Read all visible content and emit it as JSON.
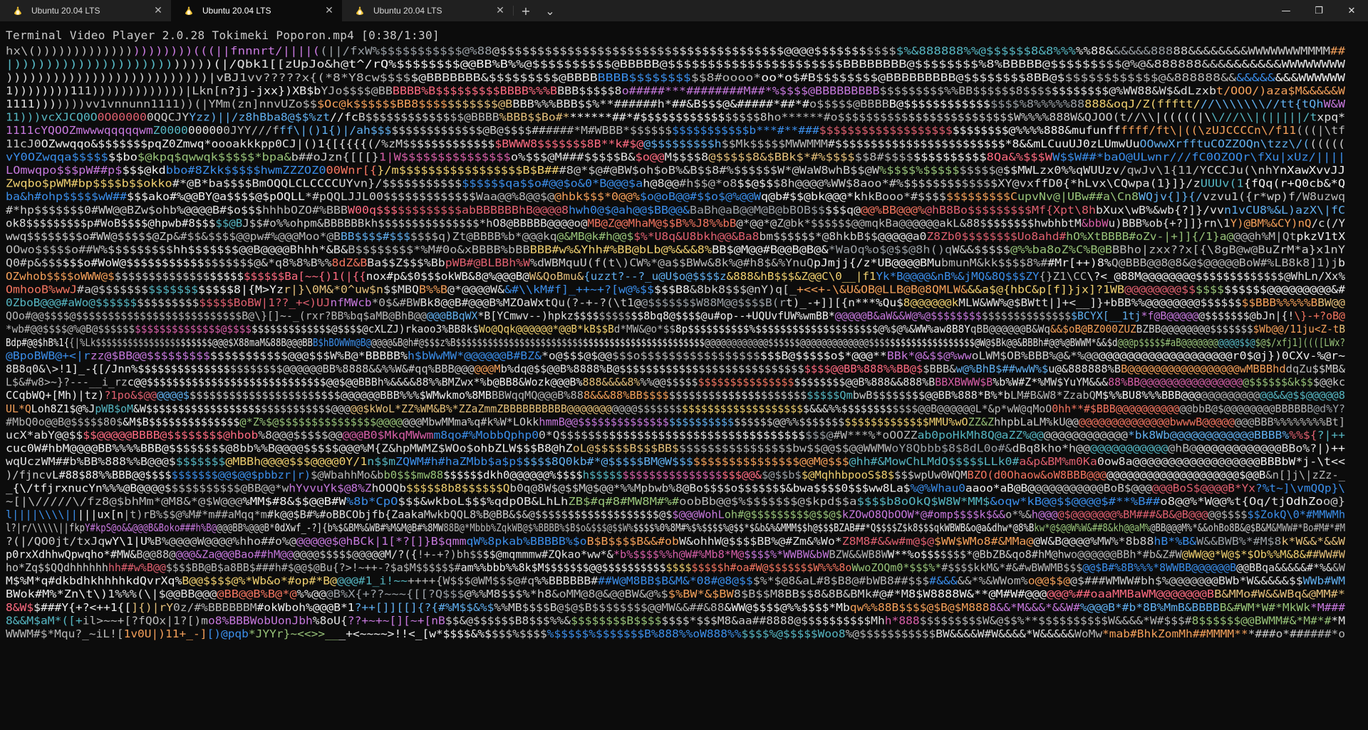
{
  "window": {
    "tabs": [
      {
        "label": "Ubuntu 20.04 LTS",
        "active": false
      },
      {
        "label": "Ubuntu 20.04 LTS",
        "active": true
      },
      {
        "label": "Ubuntu 20.04 LTS",
        "active": false
      }
    ],
    "new_tab_glyph": "+",
    "dropdown_glyph": "⌄",
    "minimize_glyph": "—",
    "maximize_glyph": "❐",
    "close_glyph": "✕",
    "tab_close_glyph": "✕"
  },
  "terminal": {
    "status": "Terminal Video Player 2.0.28 Tokimeki Poporon.mp4 [0:38/1:30]",
    "ascii_rows": [
      "hx\\()))))))))))))))))))))(((||fnnnrt/||||((||/fxW%$$$$$$$$$$$@%88@$$$$$$$$$$$$$$$$$$$$$$$$$$$$$$$$$$$$$$@@@@$$$$$$$$$$$$%&888888%%@$$$$$$8&8%%%%%88&&&&&&88888&&&&&&&&WWWWWWWMMMM##",
      "|)))))))))))))))))))))))))(|/Qbk1[[zUpJo&h@t^/rQ%$$$$$$$$@@BB%B%%@$$$$$$$$$$@BBBBB@$$$$$$$$$$$$$$$$$$$$$$BBBBBBBB@$$$$$$$$%8%BBBBB@$$$$$$$$$@%@&888888&&&&&&&&&&WWWWWWWW",
      "))))))))))))))))))))))))))|vBJ1vv?????x{(*8*Y8cw$$$$$@BBBBBBB&$$$$$$$$$@BBBBBBBB$$$$$$$$$$8#oooo*oo*o$#B$$$$$$$$@BBBBBBBBB@$$$$$$$$8BB@$$$$$$$$$$$$$@&888888&&&&&&&&&&WWWWWW",
      "1))))))))111)))))))))))))|Lkn[n?jj-jxx})XB$bYJo$$$$@BBBBBB%B$$$$$$$$$BBBB%%%BBBB$$$$$8o#####***########M##*%$$$$@BBBBBBBBB$$$$$$$$$%%BB$$$$$$8$$$$$$$$$$$$@%WW88&W$&dLzxbt/OOO/)aza$M&&&&&W",
      "1111)))))))vv1vnnunn1111))(|YMm(zn]nnvUZo$$$Oc@k$$$$$$BB8$$$$$$$$$$$@BBBB%%%BBB$$%**######h*##&B$$$@&#####*##*#o$$$$$@BBBBB@$$$$$$$$$$$$$$$$%8%%%%%88888&oqJ/Z(ffftt///\\\\\\\\\\\\\\//tt{tQhW&W",
      "11)))vcXJCQ0O0O000000QQCJYYzz)||/z8hBba8@$$%zt//fcB$$$$$$$$$$$$$$@BBBB%BBB$$Bo#*******##*#$$$$$$$$$$$$$$$$$8ho******#o$$$$$$$$$$$$$$$$$$$$$$$$$W%%%%888W&QJOO(t//\\\\|(((((|\\\\///\\\\|(|||||/txpq*",
      "1111cYQOOZmwwwqqqqqwmZ0000000000JYY///fff\\|()1{)|/ah$$$$$$$$$$$$$$$$@B@$$$$######*M#WBBB*$$$$$$$$$$$$$$$$$b***#**###$$$$$$$$$$$$$$$$$$$$$$$$$$$@%%%%888&mufunffffff/ft\\|((\\zUJCCCCn\\/f11(((|\\tf",
      "11cJ0OZwwqqo&$$$$$$$pqZ0Zmwq*oooakkkpp0CJ|()1{[{{{{(/%zM$$$$$$$$$$$$$$BWWW8$$$$$$$8B**k#$@@$$$$$$$$$h$$Mk$$$$$MWWMMM#$$$$$$$$$$$$$$$$$$$$$$$$*8&&mLCuuUJ0zLUmwUuOOwwXrfftuCOZZOQn\\tzz\\/((((((",
      "vY0OZwqqa$$$$$$$bo$@kpq$qwwqk$$$$$*bpa&b##oJzn{[[[}1|W$$$$$$$$$$$$$$$o%$$$@M###$$$$$B&$o@@M$$$$8@$$$$$8&$BBk$*#%$$$$$$8#$$$$$$$$$$$$$$8Qa&%$$$WW$$W##*baO@ULwnr///fC0OZOQr\\fXu|xUz/||||",
      "LOmwqpo$$$pW##p$$$$@kdbbo#8Zkk$$$$$hwmZZZOZ000Wnr[{}/m$$$$$$$$$$$$$$$$$B$B###8@*$@#@BW$oh$oB%&B$$8#%$$$$$$W*@WaW8whB$$@W%$$$$%$$$$$$$$$$@$$MWLzx0%%qWUUzv/qwJv\\1{11/YCCCJu(\\nhYnXawXvvJJ",
      "Zwqbo$pWM#bp$$$$b$$okko#*@B*ba$$$$BmOQQLCLCCCCUYvn}/$$$$$$$$$$$$$$$$$qa$$o#@@$o&0*B@@@$ah@8@@#h$$@*o8$$@$$$8h@@@@%WW$8aoo*#%$$$$$$$$$$$$$XY@vxffD0{*hLvx\\CQwpa(1}]}/zUUUv(1{fQq(r+Q0cb&*Q",
      "ba&h#ohp$$$$$wW##$$$ako#%@@BY@a$$$$@$pOQLL*#pQQLJJL00$$$$$$$$$$$$$Waa@@%8@@$@@hbk$$$*0@@%$o@oB@@#$$o$@%@@Wq@b#$$@bk@@@*khkBooo*#$$$$$$$$$$$$$CupvNv@|UBw##a\\Cn8WQjv{]}{/vzvu1({r*wp)f/W8uzwq",
      "#*hp$$$$$$$0#WW@@BZw$ohb%@@@@B#$o$$$hhhbOZO#%BBBW00q$$$$$$$$$$$$abBBBBBBhB@@@@8hwh0@$@ah@@$BB@@&BaBh@aB@@M@B@bBOB$$$$$q@@@%BB@@@%@hB8Bo$$$$$$$$$Mf{Xpt\\8hbXux\\wB%&wb{?]}/vvn1vCU8%&L)azX\\|fC",
      "ok8$$$$$$$$$p#WoB$$$$@hpwb#8$$$$$@BJ$$#o%%ohpm&BBBBBBkh$$$$$$$$$$$$$$$*hO8@BBBBB@@@@o@MB@Z@@MhaM@$$B%%J8%%bB@*@@*@Z@bk*$$$$$$@@mqkBa@@@@@@akL&88$$$$$$$$hwbhbtM&bbWu)BBB%ob{+?]]}rn\\1Y)@BM%&CY)nQ/c(/Y",
      "wwq$$$$$$$$o#WW@$$$$$@Zp&#$$&$$$$@@pw#%@@@Moo*@BBB$$$$#$$$$$$$q)Zt@BBBB%b*@@@kq@&MB@k#h@@$$%*U8q&U8bkh@@&Ba8bm$$$$$$*@8hkbB$$@@@@@a0Z8Zb0$$$$$$$$Uo8ahd#hO%XtBBBB#oZv-|+]]{/1}a@@@@h%M|QtpkzV1tX",
      "OOwo$$$$$o##W%$$$$$$$$$hh$$$$$$$@@B@@@@Bhhh*&B&B$$$$$$$$*%M#0o&xBBBB%bBBBBB#w%&Yhh#%BB@bLb@%&&&8%BB$@M@@#B@@B@B@&*WaOq%o$@$$@8h()qW&&$$$$$@%%ba8oZ%C%B@BBBho|zxx??x[{\\8gB@w@BuZrM*a}x1nY",
      "Q0#p&$$$$$$o#WoW@$$$$$$$$$$$$$$$$$$@&*q8%8%B%%8dZ&BBa$$Z$$$%BbpWB#@BLBBh%W%dWBMquU(f(t\\)CW%*@a$$BWw&8k%@#h8$&%YnuQpJmjj{/z*UB@@@@BMubmunM&kk$$$$8%##Mr[++)8%Q@BBB@@8@8&@$@@@@@BoW#%LB8k8]1)jb",
      "OZwhob$$$$oWWW@$$$$$$$$$$$$$$$$$$$$$$$$$$Ba[~~{)1(|{{nox#p&$0$$$okWB&8@%@@@B@W&QoBmu&{uzzt?--?_u@U$o@$$$$z&888&hB$$$&Z@@C\\0__|f1Yk*B@@@@&nB%&jMQ&8Q$$$ZY{}Z1\\CC\\?<_@88M@@@@@@@@$$$$$$$$$$$$$@WhLn/Xx%",
      "OmhooB%wwJ#a@$$$$$$$$$$$$$$$$$$$8|{M>Yzr|}\\0M&*0^uw$n$$MBQB%%B@*@@@@W&&#\\\\kM#f]_++~+?[w@%$$$$$B8&8bk8$$$@nY)q[_+<<+-\\&U&OB@LLB@B@8QMLW&&&a$@{hbC&p[f]}jx]?1WB@@@@@@@@$$$$$$$$$$$$@@@@@@@@@&#",
      "0ZboB@@@#aWo@$$$$$$$$$$$$$$$$$$$$BoBW|1??_+<)UJnfMWcb*0$&#BWBk8@@B#@@@B%MZOaWxtQu(?-+-?(\\t1@@$$$$$$$W88M@@$$$$B(rt)_-+]][{n***%Qu$8@@@@@@kMLW&WW%@$BWtt|]+<__]}+bBB%%@@@@@@@@$$$$$$$$BBB%%%%%BBW@@",
      "QOo#@@$$$$@$$$$$$$$$$$$$$$$$$$$$$$$$$B@\\}[]~-_(rxr?BB%bq$aMB@BhB@@@@@BBqWX*B[YCmwv--)hpkz$$$$$$$$$$$8bq8@$$$$@u#op--+UQUvfUW%wmBB*@@@@@B&aW&&W@%@$$$$$$$$$$$$$$$$$$$$$$$BCYX[__1tj*f@B@@@@@@$$$$$$$@bJn|{!\\}-+?oB@",
      "*wb#@@$$$$@%@B@$$$$$$$$$$$$$$$$$$$$@$$$$$$$$$$$$$$$$$@$$$$@cXLZJ)rkaoo3%BB8k$Wo@Qqk@@@@@@*@@B*kB$$Bd*MW&@o*$$8p$$$$$$$$$$%$$$$$$$$$$$$$$$$$$$$@%$@%&WW%aw8B8YqBB@@@@@@B&Wq&&$oB@BZ000ZUZBZBB@@@@@@@@$$$$$$$$Wb@@/11ju<Z-tB",
      "Bdp#@@$hB%1{{|%Lk$$$$$$$$$$$$$$$$$$$$$$@@@$X88maM&88B@@@BBB$hBOWWm@B@@@@@&B@h#@$$$z%B$$$$$$$$$$$$$$$$$$$$$$$$$$$$$$$$$$$$$$$$$$$$$$$@@@@@@@@@@@@$$$$$$@@@@@@@@@@@@@$$$$$$$$$$$$$$$$$$$$@W@$Bk@@&BBBh#@@%@BWWM*&&$d@@@p$$$$$#aB@@@@@@@@@@@$$@$@$/xfj1]((([LWx?",
      "@BpoBWB@+<|rzz@$BB@@$$$$$$$$$$$$$$$$$$$$@@@$$$W%B@*BBBBB%h$bWwMW*@@@@@@B#BZ&*o@$$$@$@@$$$o$$$$$$$$$$$$$$$$$$$$B@$$$$$o$*@@@**BBk*@&$$@%wwoLWM$OB%BBB%@&*%@@@@@@@@@@@@@@@@@@@@@r0$@j})0CXv-%@r~",
      "8B8q0&\\>!1]_-{[/Jnn%$$$$$$$$$$$$$$$$$$$$$$@@@@@@BB%8888&&%%W&#qq%BBB@@@@@@Mb%dq@$$@@B%8888%B@$$$$$$$$$$$$$$$$$$$$$$$$$$$$$$$$@@BB%888%%BB@$$BBB&w@%BhB$##wwW%$u@&888888%BB@@@@@@@@@@@@@@@@@wMBBBhddqZu$$MB&",
      "L$&#w8>~}?---__i_rzc@@$$$$$$$$$$$$$$$$$$$$$$$$$$$$@@$@@BBBh%&&&&88%%BMZwx*%b@BB8&Wozk@@@B%888&&&&8%%%@@$$$$$$$$$$$$$$$$$$$$$$$$$$$$@@B%888&&888%BBBXBWWW$B%b%W#Z*%MW$YuYM&&&88%BB@@@@@@@@@@@@@@@@@$$$$$$&k$$$@@kc",
      "CCqbWQ+[Mh)|tz)?1po&$@@@@@@$$$$$$$$$$$$$$$$$$$$$$$$@@@@@@BBB%%%$WMwkmo%8MBBBWqqMQ@@@B%888&&&88%BB$$$$$$$$$$$$$$$$$$$$$$$$$$$$$$QmbwB$$$$$$$$@@BB%888*B%*bLM#B&W8*ZzabQM$%%BU8%%%BBB@@@@@@@@@@@@@@&&@$$@@@@@8",
      "UL*QLoh8Z1$@%JpWB$oM&W$$$$$$$$$$$$$$$$$$$$$$$$$$$$$@@@@@$kWoL*ZZ%WM&B%*ZZaZmmZBBBBBBBBBB@@@@@@@@@@@$$$$$$$$$$$$$$$$$$$$$$$$$$$&&&%%$$$$$$$$$$$$@@B@@@@@@L*&p*wW@qMoO0hh**#$BBB@@@@@@@@@@@@bbB@$@@@@@@@@BBBBBB@d%Y?",
      "#MbQ0o@@B@$$$$$80$&M$B$$$$$$$$$$$$$$@*Z%$@$$$$$$$$$$$$$$$@@@@@@@MbwMMma%q#k%W*LOkkhmmB@@$$$$$$$$$$$$$$$$$$$$$$$$$$$$$$@@%%$$$$$$$$$$$$$$$$$$$$MMU%wOZZ&ZhhpbLaLM%kU@@@@@@@@@@@@@@@@bwwwB@@@@@@@@BBB%%%%%%%%Bt]",
      "ucX*abY@@$$$$@@@@@BBBB@$$$$$$$$@hbob%8@@@$$$$$@@@@@B0$MkqMWwmm8qo#%MobbQphp00*Q$$$$$$$$$$$$$$$$$$$$$$$$$$$$$$$$$$$$$$@#W***%*oOOZZab0poHkMh8Q@aZZ%@@@@@@@@@@@@@@*bk8Wb@@@@@@@@@@@@BBBB%%%${?|++",
      "cuc0W#hbM@@@@BB%%%%BBB@$$$$$$$$@8bb%%B@@@@$$$$$@@@%M{Z&hpMWMZ$WOo$ohbZLW$$$B8@hZoL@$$$$$B$$$BB$$$$$$$$$$$$$$$$$bw$$@@$$@@WWMWoY8Qbbb$8$8dL0o#&dBq8kho*h@@@@@@@@@@@@@@hB@@@@@@@@@@@@@BBo%?|)++",
      "wqUczWM##b%BB%888%%B@@@$$$$$$$$@MBBh@@@@$$$@@@@0Y/1n$$mZQWM#h#haZMbb$a$p$$$$$8Q0kb#*@$$$$$BM@W$$$$$$$$$$$$$$$$$$@@M@$$$@hh#&MowChLMdO$$$$$LLk0#a&p&BM%m0Ka0ow8a@@@@@@@@@@@@@@@@@@BBBbW*j-\\t<<",
      ")/fjncvL#88$88%%BBB@@$$$$$$$$$$$@@$@@$pbbzr|r)$@WbahhMo&bb0$$$mw88$$$$$$dkh0@@@@@@%$$$$h$$$$$$$$$$$$$$$$$$$$$$$@@&$@$$b$$@MqhhbpooS$8$$$$wpUw0WQMBZO(d0Ohaow&oW8BBB@@@@@@@@@@@@@@@@@@@@@@@$@@B&n[]j\\|zZz-_",
      "_{\\/tfjrxnucYn%%%@B@@@@$$$$$$$$$$$@BB@@*whYvvuYk$@8%ZhOOQb$$$$$8b8$$$$$$Qb0q@8W$@$$M@$@@*%%Mpbwb%8@Bo$$$$o$$$$$$$&bwa$$$$0$$$ww8La$%@%Whau0aaoo*aB@B@@@@@@@@@@@BoB$@@@@@@BoS$@@@@B*Yx?%t~]\\vmQQp}\\",
      "~[|\\/////\\/fz8@$bhMm*@M8&*@$W@@@%MM$#8&$$@@B#W%8b*CpO$$$&wkboL$$$%qdpOB&LhLhZB$#q#8#MW8M#%#oobBb@@$%$$$$$$$@$kpd$$a$$$$b8oOkQ$W8W*MM$&oqw*kB@@$$@@@@$#**%B##o8@@%*W@@%t{Oq/tjOdhZoo@}",
      "l||||\\\\\\\\|||||ux[n|t)rB%$$@%M#*m##aMqq*m#k@@$B#%#oBBCObjfb{ZaakaMwkbQQL8%B@BB&$&@$$$$$$$$$$$$$$$$$$$@$$@@@WohLoh#@$$$$$$$$$@$$@$kZOwO8QbOOW*@#omp$$$$k$&&o*%&h@@@@$@@@@@@@%BM###&B&@B@@@@@$$$$$$ZokQ\\0*#MMWMh",
      "l?|r/\\\\\\\\\\||fkpY#kpS@o&&@@@B&Boko###h%B@@@@BB%@@@B*0dXwf_-?]{b%$&BM%&WB#%M&M@B#%8MW88B@*Mbbb%ZqkWB@$%BBBB%$B$o&$$$@$$W%$$$$%0%8M#%$%$$$$%@$$*$&b&%&MMM$$h@$$$BZAB##*Q$$$$Z$k8$$$qkWBWB&o@a&dhw*@8%Bkw*@$@@W%W&##8&kh@@aM%@BB@@@M%*&&ohBo8B&@$B&M&MWW#*Bo#M#*#M",
      "?(|/QO0jt/txJqwY\\1|U%B%@@@@W@@@@%hho##o%@@@@@@$@hBCk|1[*?[]}B$qmmqW%8pkab%BBBBB%$oB$B$$$$B&&#obW&ohhW@$$$$BB%@#Zm&%Wo*Z8M8#&&w#m@$@$WW$WMo8#&MMa@@W&B@@@@%MW%*8b88hB*%B&W&&BWB%*#M$8k*W&&*&&W",
      "p0rxXdhhwQpwqho*#MW&B@@88@@@@&Za@@@Bao##hM@@@@@@$$$$$@@@@@M/?({!+-+?)bh$$$$@mqmmmw#ZQkao*ww*&*b%$$$$%%h@W#%Mb8*M@$$$$%*WWBW&bWBZW&&WB8WW**%o$$$$$$$*@BbZB&qo8#hM@hwo@@@@@@BBh*#b&Z#W@WW@@*W@$*$Ob%%M&8&##WW#W",
      "ho*Zq$$QQdhhhhhhhh##w%B@@$$$$BB@B$a8BB$###h#$@@$@Bu{?>!~++-?$a$M$$$$$$#am%%bbb%%8k$M$$$$$$$@@$$$$$$$$$$$$$$$$$$$h#oa#W@$$$$$$$W%%%8oWwoZOQm0*$$$%*#$$$$kkM&*#&#wBWWMB$$$@@$B#%8B%%%*8WWBB@@@@@@B@@BBqa&&&&&#*%&&W",
      "M$%M*q#dkbdhkhhhhkdQvrXq%B@@$$$$@%*Wb&o*#op#*B@@@@#1_i!~~++++{W$$$@WM$$$@#q%%BBBBBB###W@M8BB$B&M&*08#@8@$$$%*$@8&aL#8$B8@#bWB8##$$$#&&&&&*%&WWom%o@@$$@@$###WMWW#bh$%@@@@@@@BWb*W&&&&&$$WWb#WM",
      "BWok#M%*Zn\\t\\)1%%%(\\|$@@BB@@@@BB@@B%B@*@%%@@@B%X{+??~~~{[[?Q$$$@%%M8$$$%*h8&oMM@8@&@@BW&@%$$%BW*&$BW8$B$$M8BB$$8&8B&BMk#@#*M8$W8888W&**@M#W#@@@@@@%##oaaMMBaWM@@@@@@@BB&MMo#W&&WBq&@MM#*",
      "8&W$$###Y{+?<++1{[]{)|rY0z/#%BBBBBBM#okWboh%@@@B*1?++[]][[]{?{#%M$$&%$%%MB$$$$B@$@$B$$$$$$$$@@MW&&##&88&WW@$$$$@%%$$$$*Mbqw%%88B$$$$@$B@$M8888&&*M&&&*&&W#%@@@B*#b*8B%MmB&BBBBB&#WM*W#*MkWk*M###",
      "8&&M$aM*([+il>~~+[?fQOx|1?[)mo8%BBBWobUonJbh%8oU{??+~+~[][~+[nB$$&@$$$$$$B8$$$%%&$$$$$$$$B$$$$$$$$*$$$M8&aa##8888@$$$$$$$$$$Mhh*888$$$$$$$$$W&@$$%**$$$$$$$$$$W&&&&*W#$$$#8$$$$$$@@BWMM#&*M#*#*M",
      "WWWM#$*Mqu?_~iL![1v0U|)11+_-][)@pqb*JYYr}~<<>>___+<~~~~>!!<_[w*$$$$&%$$$$%$$$$%$$$$$%$$$$$$$B%888%%oW888%%$$$$%@$$$$$Woo8%@$$$$$$$$$$$BW&&&&W#W&&&&*W&&&&&WoMw*mab#BhkZomMh##MMMM***###o*######*o"
    ],
    "palette": [
      "#cccccc",
      "#e0e0e0",
      "#b8b8b8",
      "#f0f0f0",
      "#9aa0a6",
      "#e5c07b",
      "#f0d070",
      "#f47560",
      "#e06070",
      "#d75fa8",
      "#c678dd",
      "#61afef",
      "#3b8eea",
      "#56b6c2",
      "#98c379",
      "#f5a05a",
      "#ff6b81"
    ]
  }
}
